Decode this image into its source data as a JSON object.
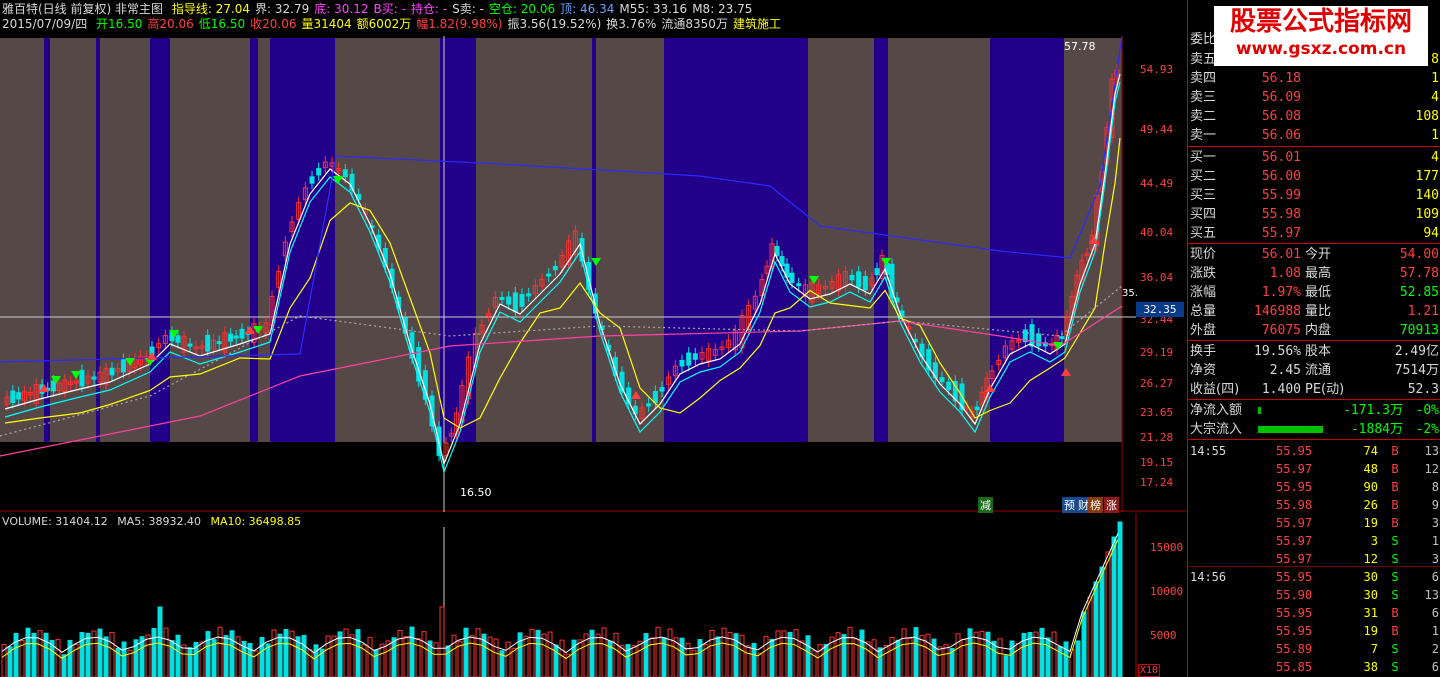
{
  "info_line1": {
    "title": "雅百特(日线 前复权) 非常主图",
    "items": [
      {
        "label": "指导线: 27.04",
        "color": "y"
      },
      {
        "label": "界: 32.79",
        "color": "w"
      },
      {
        "label": "底: 30.12",
        "color": "m"
      },
      {
        "label": "B买: -",
        "color": "m"
      },
      {
        "label": "持仓: -",
        "color": "m"
      },
      {
        "label": "S卖: -",
        "color": "w"
      },
      {
        "label": "空仓: 20.06",
        "color": "g"
      },
      {
        "label": "顶: 46.34",
        "color": "b"
      },
      {
        "label": "M55: 33.16",
        "color": "w"
      },
      {
        "label": "M8: 23.75",
        "color": "w"
      }
    ]
  },
  "info_line2": {
    "date": "2015/07/09/四",
    "items": [
      {
        "label": "开16.50",
        "color": "g"
      },
      {
        "label": "高20.06",
        "color": "r"
      },
      {
        "label": "低16.50",
        "color": "g"
      },
      {
        "label": "收20.06",
        "color": "r"
      },
      {
        "label": "量31404",
        "color": "y"
      },
      {
        "label": "额6002万",
        "color": "y"
      },
      {
        "label": "幅1.82(9.98%)",
        "color": "r"
      },
      {
        "label": "振3.56(19.52%)",
        "color": "w"
      },
      {
        "label": "换3.76%",
        "color": "w"
      },
      {
        "label": "流通8350万",
        "color": "w"
      },
      {
        "label": "建筑施工",
        "color": "y"
      }
    ]
  },
  "price_axis": [
    "54.93",
    "49.44",
    "44.49",
    "40.04",
    "36.04",
    "32.44",
    "29.19",
    "26.27",
    "23.65",
    "21.28",
    "19.15",
    "17.24"
  ],
  "current_price_tag": "32.35",
  "high_marker": "57.78",
  "low_marker": "16.50",
  "side_marker": "35.",
  "volume_legend": {
    "volume": "VOLUME: 31404.12",
    "ma5": "MA5: 38932.40",
    "ma10": "MA10: 36498.85"
  },
  "volume_axis": [
    "15000",
    "10000",
    "5000"
  ],
  "volume_unit": "X10",
  "indicator_tags": [
    "减",
    "预",
    "财",
    "榜",
    "涨"
  ],
  "watermark": {
    "title": "股票公式指标网",
    "url": "www.gsxz.com.cn"
  },
  "order_book": {
    "header": "委比",
    "sells": [
      {
        "label": "卖五",
        "price": "56.20",
        "vol": "8"
      },
      {
        "label": "卖四",
        "price": "56.18",
        "vol": "1"
      },
      {
        "label": "卖三",
        "price": "56.09",
        "vol": "4"
      },
      {
        "label": "卖二",
        "price": "56.08",
        "vol": "108"
      },
      {
        "label": "卖一",
        "price": "56.06",
        "vol": "1"
      }
    ],
    "buys": [
      {
        "label": "买一",
        "price": "56.01",
        "vol": "4"
      },
      {
        "label": "买二",
        "price": "56.00",
        "vol": "177"
      },
      {
        "label": "买三",
        "price": "55.99",
        "vol": "140"
      },
      {
        "label": "买四",
        "price": "55.98",
        "vol": "109"
      },
      {
        "label": "买五",
        "price": "55.97",
        "vol": "94"
      }
    ]
  },
  "quote": [
    {
      "k1": "现价",
      "v1": "56.01",
      "k2": "今开",
      "v2": "54.00",
      "c2": "#ff4040"
    },
    {
      "k1": "涨跌",
      "v1": "1.08",
      "k2": "最高",
      "v2": "57.78",
      "c2": "#ff4040"
    },
    {
      "k1": "涨幅",
      "v1": "1.97%",
      "k2": "最低",
      "v2": "52.85",
      "c2": "#00ff00"
    },
    {
      "k1": "总量",
      "v1": "146988",
      "k2": "量比",
      "v2": "1.21",
      "c2": "#ff4040"
    },
    {
      "k1": "外盘",
      "v1": "76075",
      "k2": "内盘",
      "v2": "70913",
      "c2": "#00ff00"
    }
  ],
  "stats": [
    {
      "k1": "换手",
      "v1": "19.56%",
      "k2": "股本",
      "v2": "2.49亿"
    },
    {
      "k1": "净资",
      "v1": "2.45",
      "k2": "流通",
      "v2": "7514万"
    },
    {
      "k1": "收益(四)",
      "v1": "1.400",
      "k2": "PE(动)",
      "v2": "52.3"
    }
  ],
  "flows": [
    {
      "k": "净流入额",
      "v": "-171.3万",
      "pct": "-0%",
      "bar": 0.03
    },
    {
      "k": "大宗流入",
      "v": "-1884万",
      "pct": "-2%",
      "bar": 0.65
    }
  ],
  "ticks": [
    {
      "time": "14:55",
      "price": "55.95",
      "vol": "74",
      "dir": "B",
      "n": "13"
    },
    {
      "time": "",
      "price": "55.97",
      "vol": "48",
      "dir": "B",
      "n": "12"
    },
    {
      "time": "",
      "price": "55.95",
      "vol": "90",
      "dir": "B",
      "n": "8"
    },
    {
      "time": "",
      "price": "55.98",
      "vol": "26",
      "dir": "B",
      "n": "9"
    },
    {
      "time": "",
      "price": "55.97",
      "vol": "19",
      "dir": "B",
      "n": "3"
    },
    {
      "time": "",
      "price": "55.97",
      "vol": "3",
      "dir": "S",
      "n": "1"
    },
    {
      "time": "",
      "price": "55.97",
      "vol": "12",
      "dir": "S",
      "n": "3"
    },
    {
      "time": "14:56",
      "price": "55.95",
      "vol": "30",
      "dir": "S",
      "n": "6"
    },
    {
      "time": "",
      "price": "55.90",
      "vol": "30",
      "dir": "S",
      "n": "13"
    },
    {
      "time": "",
      "price": "55.95",
      "vol": "31",
      "dir": "B",
      "n": "6"
    },
    {
      "time": "",
      "price": "55.95",
      "vol": "19",
      "dir": "B",
      "n": "1"
    },
    {
      "time": "",
      "price": "55.89",
      "vol": "7",
      "dir": "S",
      "n": "2"
    },
    {
      "time": "",
      "price": "55.85",
      "vol": "38",
      "dir": "S",
      "n": "6"
    }
  ]
}
